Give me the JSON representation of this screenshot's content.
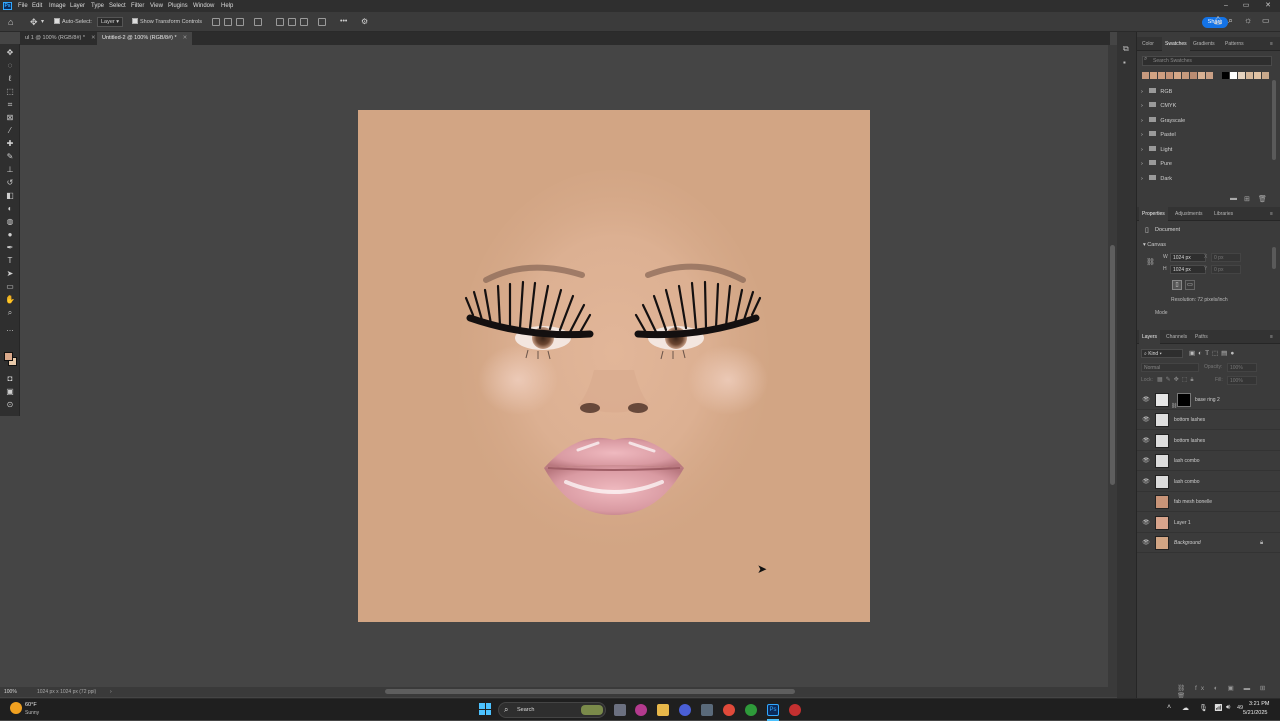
{
  "menu": {
    "logo": "Ps",
    "items": [
      "File",
      "Edit",
      "Image",
      "Layer",
      "Type",
      "Select",
      "Filter",
      "View",
      "Plugins",
      "Window",
      "Help"
    ],
    "window_controls": [
      "–",
      "▭",
      "✕"
    ]
  },
  "options_bar": {
    "auto_select_label": "Auto-Select:",
    "auto_select_target": "Layer",
    "show_transform_label": "Show Transform Controls",
    "more": "•••",
    "share_label": "Share"
  },
  "doc_tabs": [
    {
      "label": "ul 1 @ 100% (RGB/8#) *",
      "active": false
    },
    {
      "label": "Untitled-2 @ 100% (RGB/8#) *",
      "active": true
    }
  ],
  "status": {
    "zoom": "100%",
    "doc_info": "1024 px x 1024 px (72 ppi)"
  },
  "swatches_panel": {
    "tabs": [
      "Color",
      "Swatches",
      "Gradients",
      "Patterns"
    ],
    "active_tab": "Swatches",
    "search_placeholder": "Search Swatches",
    "recent_colors": [
      "#c89a7e",
      "#d2a383",
      "#cf9e80",
      "#c59377",
      "#d6a888",
      "#c69a7d",
      "#ba8c72",
      "#d9b193",
      "#caa085",
      "#000000",
      "#ffffff",
      "#e5d3bf",
      "#d6b89a",
      "#e0c2a3",
      "#c9a98c"
    ],
    "folders": [
      "RGB",
      "CMYK",
      "Grayscale",
      "Pastel",
      "Light",
      "Pure",
      "Dark"
    ]
  },
  "properties_panel": {
    "tabs": [
      "Properties",
      "Adjustments",
      "Libraries"
    ],
    "active_tab": "Properties",
    "document_label": "Document",
    "canvas_label": "Canvas",
    "w_label": "W",
    "w_value": "1024 px",
    "h_label": "H",
    "h_value": "1024 px",
    "x_label": "X",
    "x_value": "0 px",
    "y_label": "Y",
    "y_value": "0 px",
    "resolution": "Resolution: 72 pixels/inch",
    "mode_label": "Mode"
  },
  "layers_panel": {
    "tabs": [
      "Layers",
      "Channels",
      "Paths"
    ],
    "active_tab": "Layers",
    "filter_label": "Kind",
    "blend_mode": "Normal",
    "opacity_label": "Opacity:",
    "opacity_value": "100%",
    "lock_label": "Lock:",
    "fill_label": "Fill:",
    "fill_value": "100%",
    "layers": [
      {
        "name": "base ring 2",
        "visible": true,
        "thumb": "#e6e6e6",
        "has_mask": true,
        "locked": false
      },
      {
        "name": "bottom lashes",
        "visible": true,
        "thumb": "#dedede",
        "has_mask": false,
        "locked": false
      },
      {
        "name": "bottom lashes",
        "visible": true,
        "thumb": "#dedede",
        "has_mask": false,
        "locked": false
      },
      {
        "name": "lash combo",
        "visible": true,
        "thumb": "#dcdcdc",
        "has_mask": false,
        "locked": false
      },
      {
        "name": "lash combo",
        "visible": true,
        "thumb": "#dcdcdc",
        "has_mask": false,
        "locked": false
      },
      {
        "name": "fab mesh bonelle",
        "visible": false,
        "thumb": "#c89478",
        "has_mask": false,
        "locked": false
      },
      {
        "name": "Layer 1",
        "visible": true,
        "thumb": "#d8a48c",
        "has_mask": false,
        "locked": false
      },
      {
        "name": "Background",
        "visible": true,
        "thumb": "#d2a584",
        "has_mask": false,
        "locked": true
      }
    ]
  },
  "taskbar": {
    "weather_temp": "60°F",
    "weather_desc": "Sunny",
    "search_label": "Search",
    "time": "3:21 PM",
    "date": "5/21/2025",
    "volume": "49"
  },
  "colors": {
    "canvas": "#d2a584",
    "foreground": "#d9a88a",
    "background": "#e8c9a9",
    "accent": "#1473e6"
  }
}
